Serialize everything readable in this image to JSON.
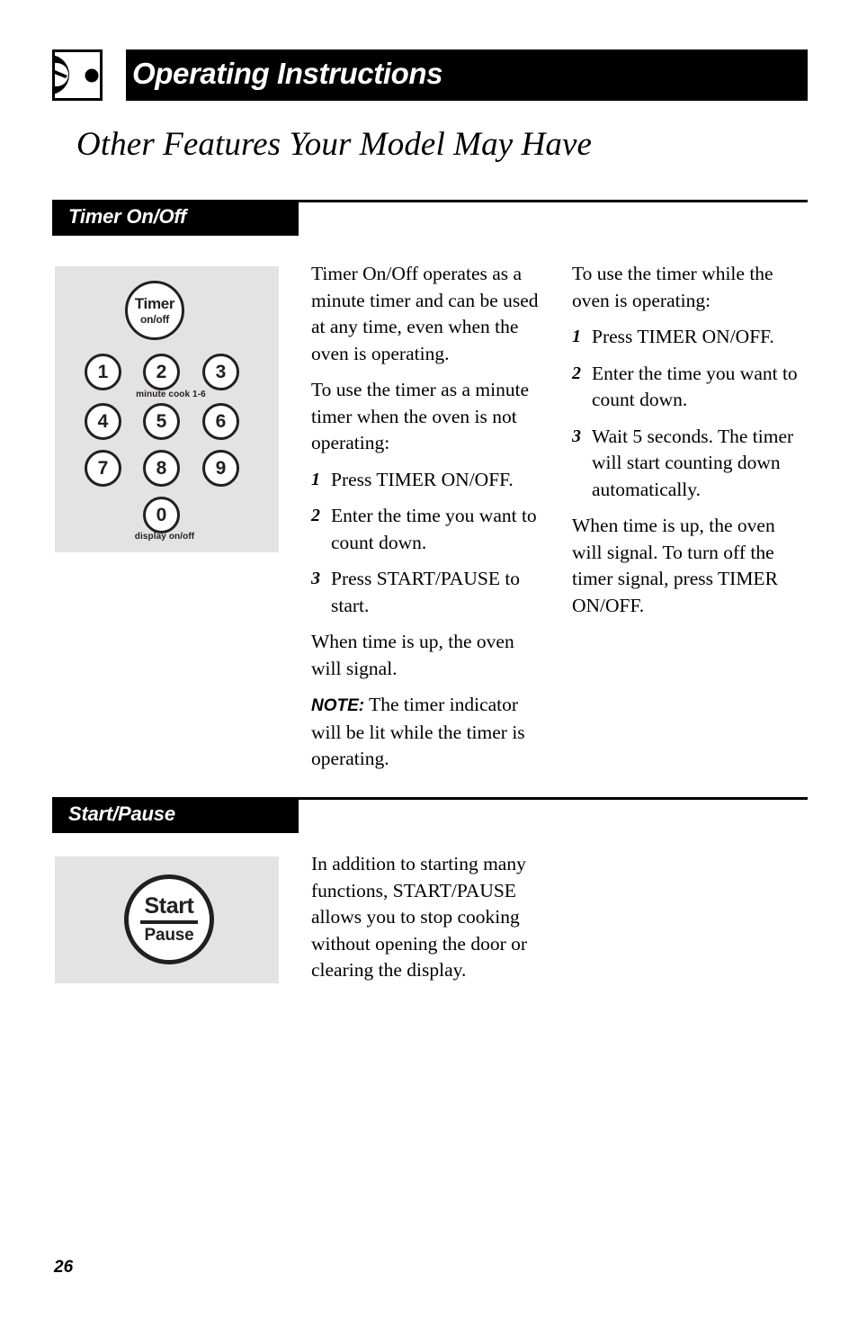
{
  "header": {
    "icon_name": "oven-dial-icon",
    "title": "Operating Instructions"
  },
  "page_title": "Other Features Your Model May Have",
  "page_number": "26",
  "colors": {
    "bar": "#000000",
    "panel_background": "#e3e3e3",
    "key_outline": "#231f20",
    "text": "#000000"
  },
  "sections": [
    {
      "id": "timer-on-off",
      "heading": "Timer On/Off",
      "illustration": {
        "type": "keypad",
        "timer_key": {
          "main": "Timer",
          "sub": "on/off"
        },
        "number_keys": [
          "1",
          "2",
          "3",
          "4",
          "5",
          "6",
          "7",
          "8",
          "9"
        ],
        "zero_key": "0",
        "captions": {
          "minute_cook": "minute cook 1-6",
          "display": "display on/off"
        }
      },
      "middle_column": {
        "intro": "Timer On/Off operates as a minute timer and can be used at any time, even when the oven is operating.",
        "lead_in": "To use the timer as a minute timer when the oven is not operating:",
        "steps": [
          {
            "num": "1",
            "text": "Press TIMER ON/OFF."
          },
          {
            "num": "2",
            "text": "Enter the time you want to count down."
          },
          {
            "num": "3",
            "text": "Press START/PAUSE to start."
          }
        ],
        "closing": "When time is up, the oven will signal.",
        "note_label": "NOTE:",
        "note_text": " The timer indicator will be lit while the timer is operating."
      },
      "right_column": {
        "lead_in": "To use the timer while the oven is operating:",
        "steps": [
          {
            "num": "1",
            "text": "Press TIMER ON/OFF."
          },
          {
            "num": "2",
            "text": "Enter the time you want to count down."
          },
          {
            "num": "3",
            "text": "Wait 5 seconds. The timer will start counting down automatically."
          }
        ],
        "closing": "When time is up, the oven will signal. To turn off the timer signal, press TIMER ON/OFF."
      }
    },
    {
      "id": "start-pause",
      "heading": "Start/Pause",
      "illustration": {
        "type": "round-button",
        "main": "Start",
        "sub": "Pause"
      },
      "middle_column": {
        "intro": "In addition to starting many functions, START/PAUSE allows you to stop cooking without opening the door or clearing the display."
      }
    }
  ]
}
